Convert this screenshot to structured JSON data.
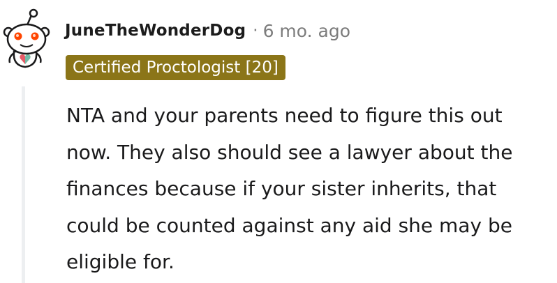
{
  "comment": {
    "author": "JuneTheWonderDog",
    "separator": "·",
    "timestamp": "6 mo. ago",
    "flair": "Certified Proctologist [20]",
    "body": "NTA and your parents need to figure this out now. They also should see a lawyer about the finances because if your sister inherits, that could be counted against any aid she may be eligible for."
  },
  "colors": {
    "flair_background": "#8b7518",
    "flair_text": "#ffffff",
    "meta_text": "#7c7c7c",
    "thread_line": "#edeff1",
    "avatar_accent": "#ff4500"
  },
  "icons": {
    "avatar": "snoo-avatar-icon"
  }
}
